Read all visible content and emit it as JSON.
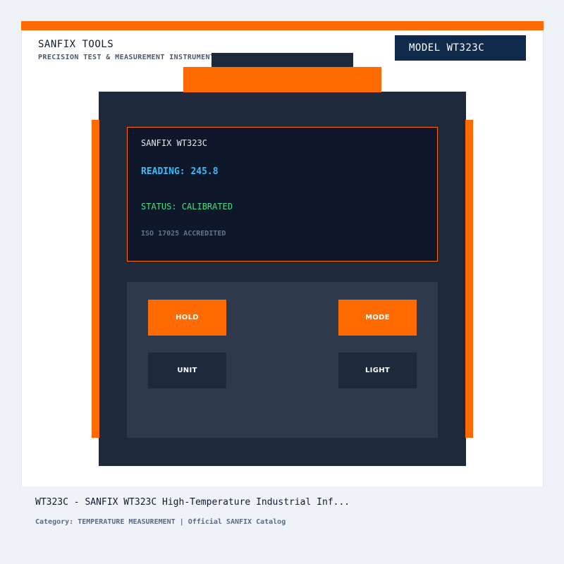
{
  "header": {
    "brand_name": "SANFIX TOOLS",
    "tagline": "PRECISION TEST & MEASUREMENT INSTRUMENTS",
    "model_badge": "MODEL WT323C"
  },
  "device": {
    "screen": {
      "title": "SANFIX WT323C",
      "reading": "READING: 245.8",
      "status": "STATUS: CALIBRATED",
      "certification": "ISO 17025 ACCREDITED"
    },
    "keys": {
      "hold": "HOLD",
      "mode": "MODE",
      "unit": "UNIT",
      "light": "LIGHT"
    }
  },
  "footer": {
    "title": "WT323C - SANFIX WT323C High-Temperature Industrial Inf...",
    "meta": "Category: TEMPERATURE MEASUREMENT | Official SANFIX Catalog"
  },
  "colors": {
    "accent": "#ff6b00",
    "device_body": "#1e293b",
    "screen_bg": "#0f172a",
    "reading": "#38bdf8",
    "status_ok": "#4ade80",
    "badge_bg": "#0f2a4a"
  }
}
